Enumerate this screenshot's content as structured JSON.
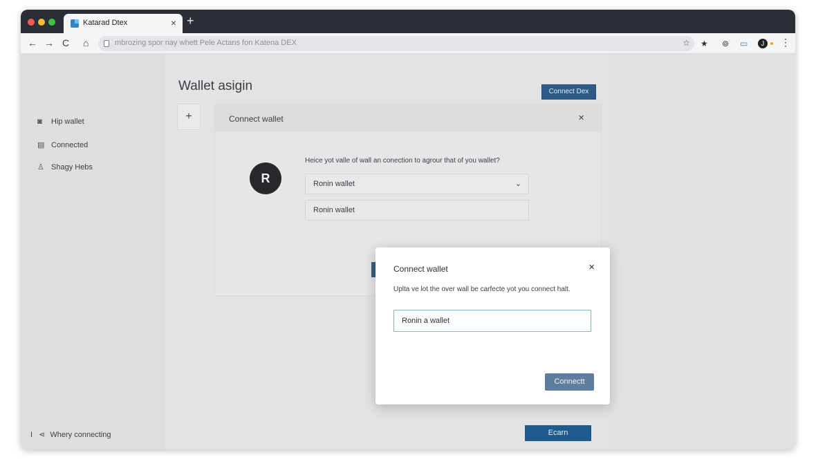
{
  "browser": {
    "tab_title": "Katarad Dtex",
    "tab_close_glyph": "×",
    "new_tab_glyph": "+",
    "back_glyph": "←",
    "forward_glyph": "→",
    "reload_glyph": "C",
    "home_glyph": "⌂",
    "url": "mbrozing spor nay whett Pele Actans fon Katena DEX",
    "star_glyph": "☆",
    "bookmark_glyph": "★",
    "ext1_glyph": "⊚",
    "ext2_glyph": "▭",
    "profile_initial": "J",
    "menu_glyph": "⋮"
  },
  "sidebar": {
    "items": [
      {
        "icon": "camera-icon",
        "glyph": "◙",
        "label": "Hip wallet"
      },
      {
        "icon": "card-icon",
        "glyph": "▤",
        "label": "Connected"
      },
      {
        "icon": "user-icon",
        "glyph": "♙",
        "label": "Shagy Hebs"
      }
    ],
    "footer_prefix": "I",
    "footer_icon_glyph": "⋖",
    "footer_label": "Whery connecting"
  },
  "main": {
    "title": "Wallet asigin",
    "plus_glyph": "+",
    "connect_dex_label": "Connect Dex",
    "earn_label": "Ecarn"
  },
  "bg_dialog": {
    "title": "Connect wallet",
    "close_glyph": "×",
    "logo_text": "R",
    "question": "Heice yot valle of wall an conection to agrour that of you wallet?",
    "select_value": "Ronin wallet",
    "select_chevron": "⌄",
    "option_label": "Ronin wallet"
  },
  "modal": {
    "title": "Connect wallet",
    "close_glyph": "×",
    "description": "Uplta ve lot the over wall be carfecte yot you connect halt.",
    "input_value": "Ronin a wallet",
    "connect_label": "Connectt"
  },
  "colors": {
    "primary_button": "#1f5a8e",
    "modal_button": "#5f7d9e",
    "input_border": "#7fb7c2"
  }
}
